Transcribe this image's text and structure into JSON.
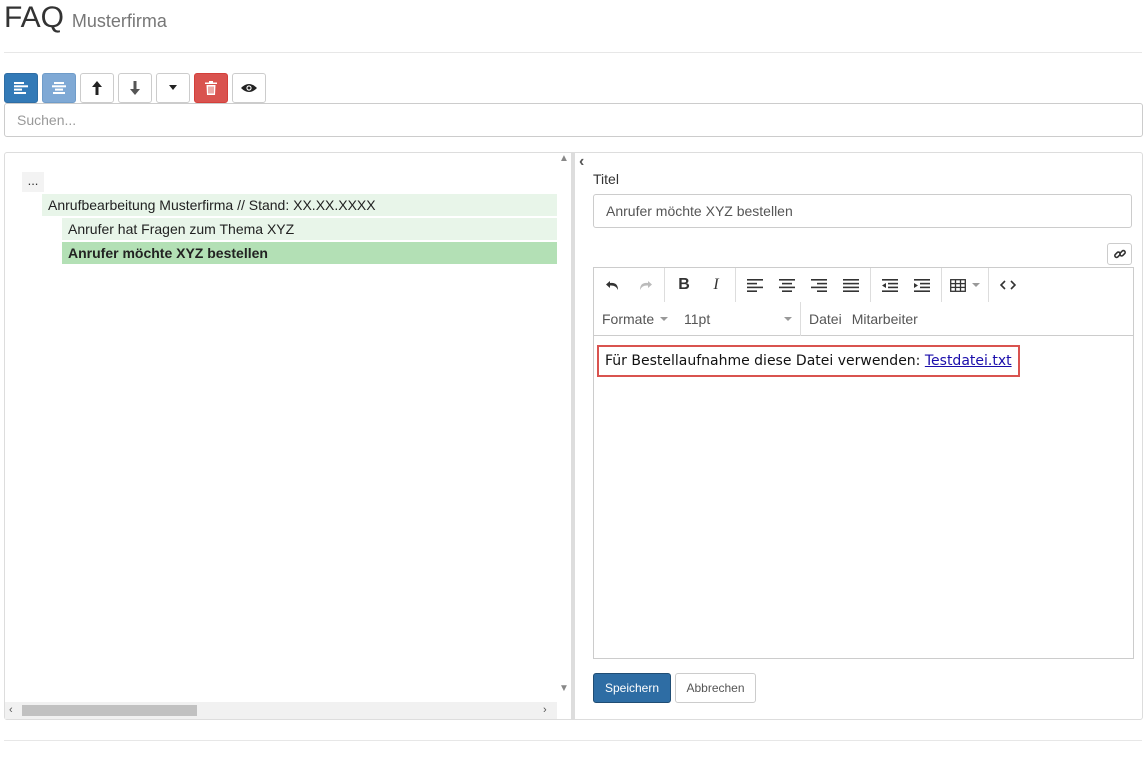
{
  "header": {
    "title": "FAQ",
    "subtitle": "Musterfirma"
  },
  "toolbar": {
    "buttons": [
      {
        "name": "align-left",
        "style": "blue",
        "icon": "align-left-icon"
      },
      {
        "name": "align-center",
        "style": "light-blue",
        "icon": "align-center-icon"
      },
      {
        "name": "move-up",
        "style": "default",
        "icon": "arrow-up-icon"
      },
      {
        "name": "move-down",
        "style": "default",
        "icon": "arrow-down-icon"
      },
      {
        "name": "more",
        "style": "default",
        "icon": "caret-down-icon"
      },
      {
        "name": "delete",
        "style": "red",
        "icon": "trash-icon"
      },
      {
        "name": "preview",
        "style": "default",
        "icon": "eye-icon"
      }
    ]
  },
  "search": {
    "placeholder": "Suchen..."
  },
  "tree": {
    "root_label": "...",
    "items": [
      {
        "label": "Anrufbearbeitung Musterfirma // Stand: XX.XX.XXXX",
        "level": 1,
        "selected": false
      },
      {
        "label": "Anrufer hat Fragen zum Thema XYZ",
        "level": 2,
        "selected": false
      },
      {
        "label": "Anrufer möchte XYZ bestellen",
        "level": 2,
        "selected": true
      }
    ]
  },
  "detail": {
    "title_label": "Titel",
    "title_value": "Anrufer möchte XYZ bestellen",
    "editor": {
      "menu": {
        "formats": "Formate",
        "font_size": "11pt",
        "file": "Datei",
        "staff": "Mitarbeiter"
      },
      "content_text": "Für Bestellaufnahme diese Datei verwenden: ",
      "content_link": "Testdatei.txt"
    },
    "save_label": "Speichern",
    "cancel_label": "Abbrechen"
  },
  "colors": {
    "primary": "#337ab7",
    "danger": "#d9534f",
    "tree_highlight": "#e8f5e9",
    "tree_selected": "#b3e0b5"
  }
}
